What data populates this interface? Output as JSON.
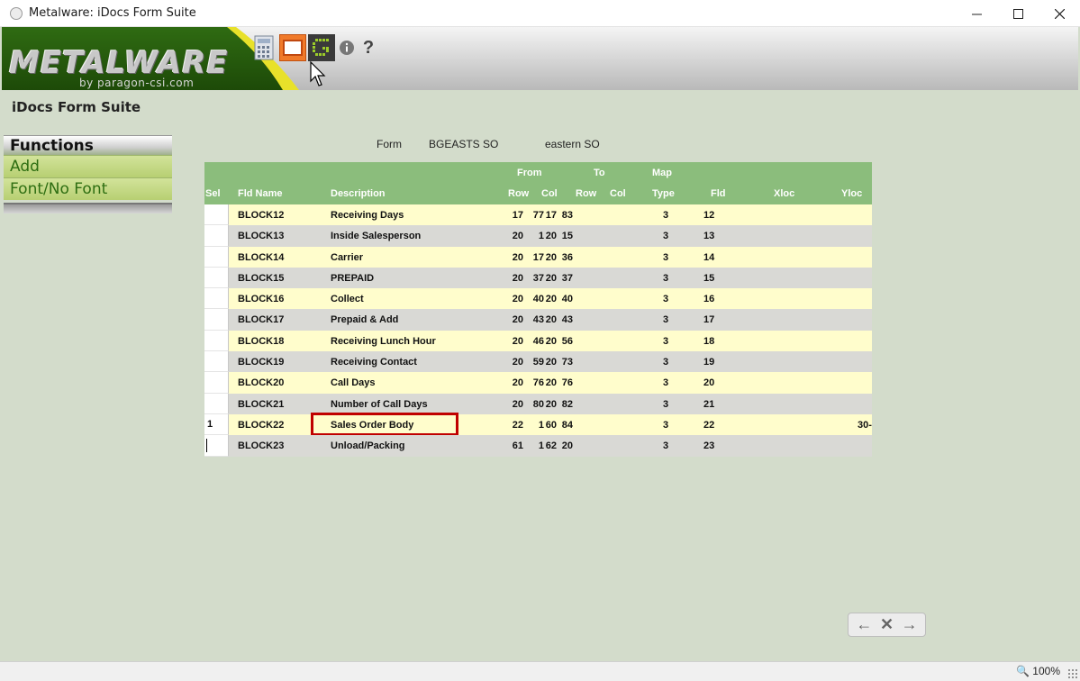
{
  "window": {
    "title": "Metalware: iDocs Form Suite"
  },
  "header": {
    "logo_text": "METALWARE",
    "logo_sub": "by paragon-csi.com"
  },
  "page_title": "iDocs Form Suite",
  "functions": {
    "heading": "Functions",
    "items": [
      "Add",
      "Font/No Font"
    ]
  },
  "form": {
    "label": "Form",
    "code": "BGEASTS SO",
    "name": "eastern SO"
  },
  "table": {
    "group_headers": {
      "from": "From",
      "to": "To",
      "map": "Map"
    },
    "headers": {
      "sel": "Sel",
      "fld_name": "Fld Name",
      "description": "Description",
      "from_row": "Row",
      "from_col": "Col",
      "to_row": "Row",
      "to_col": "Col",
      "type": "Type",
      "fld": "Fld",
      "xloc": "Xloc",
      "yloc": "Yloc"
    },
    "rows": [
      {
        "sel": "",
        "name": "BLOCK12",
        "desc": "Receiving Days",
        "fr": "17",
        "fc": "77",
        "tr": "17",
        "tc": "83",
        "type": "3",
        "fld": "12",
        "yloc": ""
      },
      {
        "sel": "",
        "name": "BLOCK13",
        "desc": "Inside Salesperson",
        "fr": "20",
        "fc": "1",
        "tr": "20",
        "tc": "15",
        "type": "3",
        "fld": "13",
        "yloc": ""
      },
      {
        "sel": "",
        "name": "BLOCK14",
        "desc": "Carrier",
        "fr": "20",
        "fc": "17",
        "tr": "20",
        "tc": "36",
        "type": "3",
        "fld": "14",
        "yloc": ""
      },
      {
        "sel": "",
        "name": "BLOCK15",
        "desc": "PREPAID",
        "fr": "20",
        "fc": "37",
        "tr": "20",
        "tc": "37",
        "type": "3",
        "fld": "15",
        "yloc": ""
      },
      {
        "sel": "",
        "name": "BLOCK16",
        "desc": "Collect",
        "fr": "20",
        "fc": "40",
        "tr": "20",
        "tc": "40",
        "type": "3",
        "fld": "16",
        "yloc": ""
      },
      {
        "sel": "",
        "name": "BLOCK17",
        "desc": "Prepaid & Add",
        "fr": "20",
        "fc": "43",
        "tr": "20",
        "tc": "43",
        "type": "3",
        "fld": "17",
        "yloc": ""
      },
      {
        "sel": "",
        "name": "BLOCK18",
        "desc": "Receiving Lunch Hour",
        "fr": "20",
        "fc": "46",
        "tr": "20",
        "tc": "56",
        "type": "3",
        "fld": "18",
        "yloc": ""
      },
      {
        "sel": "",
        "name": "BLOCK19",
        "desc": "Receiving Contact",
        "fr": "20",
        "fc": "59",
        "tr": "20",
        "tc": "73",
        "type": "3",
        "fld": "19",
        "yloc": ""
      },
      {
        "sel": "",
        "name": "BLOCK20",
        "desc": "Call Days",
        "fr": "20",
        "fc": "76",
        "tr": "20",
        "tc": "76",
        "type": "3",
        "fld": "20",
        "yloc": ""
      },
      {
        "sel": "",
        "name": "BLOCK21",
        "desc": "Number of Call Days",
        "fr": "20",
        "fc": "80",
        "tr": "20",
        "tc": "82",
        "type": "3",
        "fld": "21",
        "yloc": ""
      },
      {
        "sel": "1",
        "name": "BLOCK22",
        "desc": "Sales Order Body",
        "fr": "22",
        "fc": "1",
        "tr": "60",
        "tc": "84",
        "type": "3",
        "fld": "22",
        "yloc": "30-"
      },
      {
        "sel": "",
        "name": "BLOCK23",
        "desc": "Unload/Packing",
        "fr": "61",
        "fc": "1",
        "tr": "62",
        "tc": "20",
        "type": "3",
        "fld": "23",
        "yloc": ""
      }
    ]
  },
  "status": {
    "zoom": "100%"
  }
}
